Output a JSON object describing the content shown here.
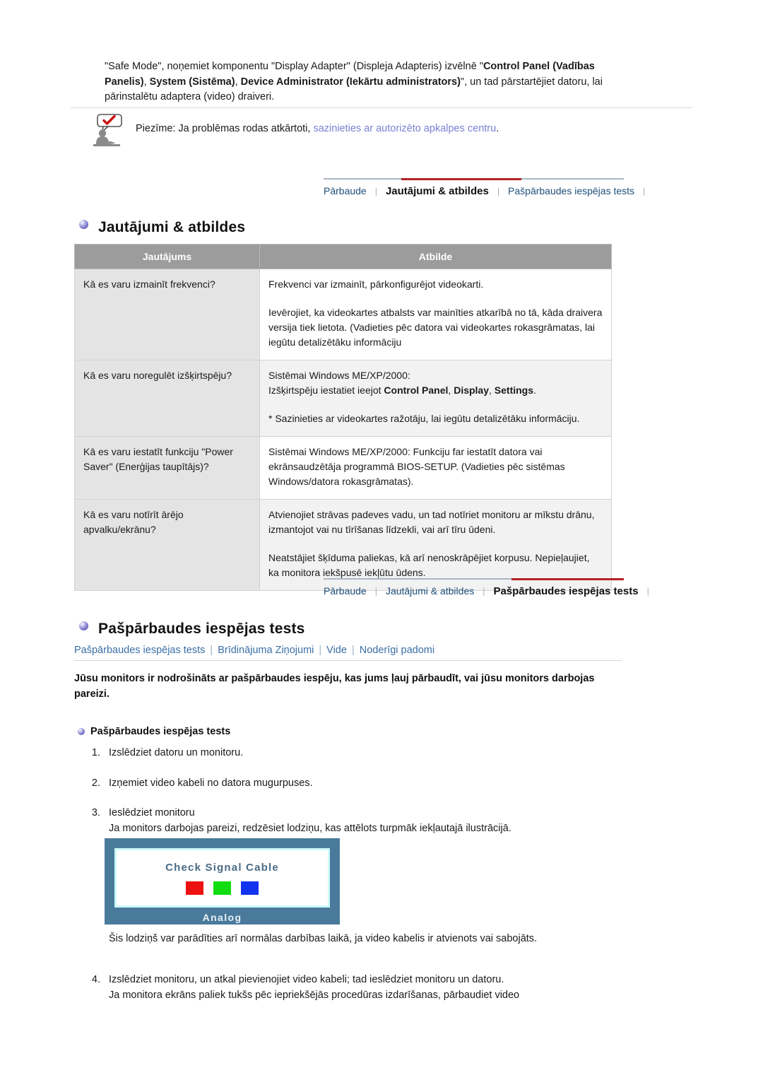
{
  "intro": {
    "line1_a": "\"Safe Mode\", noņemiet komponentu \"Display Adapter\" (Displeja Adapteris) izvēlnē \"",
    "line1_bold": "Control Panel (Vadības Panelis)",
    "line1_b": ", ",
    "line2_bold1": "System (Sistēma)",
    "line2_b": ", ",
    "line2_bold2": "Device Administrator (Iekārtu administrators)",
    "line2_c": "\", ",
    "line3": "un tad pārstartējiet datoru, lai pārinstalētu adaptera (video) draiveri."
  },
  "note": {
    "icon": "note-person-checkmark-icon",
    "prefix": "Piezīme:  Ja problēmas rodas atkārtoti, ",
    "link": "sazinieties ar autorizēto apkalpes centru",
    "suffix": ".",
    "link_color": "#7b7fd4"
  },
  "tabstrip_faq": {
    "tabs": [
      {
        "label": "Pārbaude",
        "active": false
      },
      {
        "label": "Jautājumi & atbildes",
        "active": true
      },
      {
        "label": "Pašpārbaudes iespējas tests",
        "active": false
      }
    ],
    "separator": "❘",
    "active_color": "#b52025"
  },
  "faq_section": {
    "title": "Jautājumi & atbildes",
    "headers": [
      "Jautājums",
      "Atbilde"
    ],
    "rows": [
      {
        "question": "Kā es varu izmainīt frekvenci?",
        "answer_paras": [
          "Frekvenci var izmainīt, pārkonfigurējot videokarti.",
          "Ievērojiet, ka videokartes atbalsts var mainīties atkarībā no tā, kāda draivera versija tiek lietota. (Vadieties pēc datora vai videokartes rokasgrāmatas, lai iegūtu detalizētāku informāciju"
        ]
      },
      {
        "question": "Kā es varu noregulēt izšķirtspēju?",
        "answer_paras": [
          "Sistēmai Windows ME/XP/2000:",
          "* Sazinieties ar videokartes ražotāju, lai iegūtu detalizētāku informāciju."
        ],
        "answer_rich_line": {
          "pre": "Izšķirtspēju iestatiet ieejot ",
          "b1": "Control Panel",
          "mid1": ", ",
          "b2": "Display",
          "mid2": ", ",
          "b3": "Settings",
          "post": "."
        }
      },
      {
        "question": "Kā es varu iestatīt funkciju \"Power Saver\" (Enerģijas taupītājs)?",
        "answer_paras": [
          "Sistēmai Windows ME/XP/2000: Funkciju far iestatīt datora vai ekrānsaudzētāja programmā BIOS-SETUP. (Vadieties pēc sistēmas Windows/datora rokasgrāmatas)."
        ]
      },
      {
        "question": "Kā es varu notīrīt ārējo apvalku/ekrānu?",
        "answer_paras": [
          "Atvienojiet strāvas padeves vadu, un tad notīriet monitoru ar mīkstu drānu, izmantojot vai nu tīrīšanas līdzekli, vai arī tīru ūdeni.",
          "Neatstājiet šķīduma paliekas, kā arī nenoskrāpējiet korpusu. Nepieļaujiet, ka monitora iekšpusē iekļūtu ūdens."
        ]
      }
    ]
  },
  "tabstrip_selftest": {
    "tabs": [
      {
        "label": "Pārbaude",
        "active": false
      },
      {
        "label": "Jautājumi & atbildes",
        "active": false
      },
      {
        "label": "Pašpārbaudes iespējas tests",
        "active": true
      }
    ],
    "separator": "❘"
  },
  "selftest_section": {
    "title": "Pašpārbaudes iespējas tests",
    "subnav": [
      "Pašpārbaudes iespējas tests",
      "Brīdinājuma Ziņojumi",
      "Vide",
      "Noderīgi padomi"
    ],
    "subnav_sep": "|",
    "lead": "Jūsu monitors ir nodrošināts ar pašpārbaudes iespēju, kas jums ļauj pārbaudīt, vai jūsu monitors darbojas pareizi.",
    "sub_heading": "Pašpārbaudes iespējas tests",
    "steps": [
      {
        "num": "1.",
        "text": "Izslēdziet datoru un monitoru."
      },
      {
        "num": "2.",
        "text": "Izņemiet video kabeli no datora mugurpuses."
      },
      {
        "num": "3.",
        "text": "Ieslēdziet monitoru",
        "line2": "Ja monitors darbojas pareizi, redzēsiet lodziņu, kas attēlots turpmāk iekļautajā ilustrācijā."
      }
    ],
    "monitor_image": {
      "message": "Check Signal Cable",
      "label": "Analog",
      "swatch_colors": [
        "#ee1111",
        "#11dd11",
        "#1133ee"
      ],
      "frame_color": "#4a7a9b",
      "inner_border_color": "#cdfaf8"
    },
    "after_image": "Šis lodziņš var parādīties arī normālas darbības laikā, ja video kabelis ir atvienots vai sabojāts.",
    "step4": {
      "num": "4.",
      "text": "Izslēdziet monitoru, un atkal pievienojiet video kabeli; tad ieslēdziet monitoru un datoru.",
      "line2": "Ja monitora ekrāns paliek tukšs pēc iepriekšējās procedūras izdarīšanas, pārbaudiet video"
    }
  }
}
